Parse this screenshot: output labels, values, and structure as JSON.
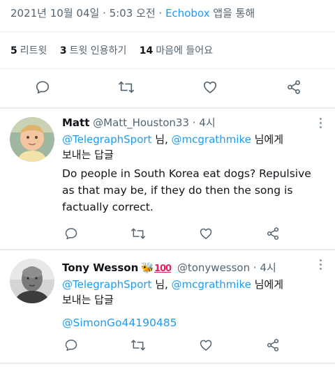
{
  "tweet": {
    "timestamp": "2021년 10월 04일 · 5:03 오전 · ",
    "source_link": "Echobox",
    "source_suffix": " 앱을 통해",
    "retweets_count": "5",
    "retweets_label": "리트윗",
    "quotes_count": "3",
    "quotes_label": "트윗 인용하기",
    "likes_count": "14",
    "likes_label": "마음에 들어요"
  },
  "replies": [
    {
      "name": "Matt",
      "handle": "@Matt_Houston33",
      "time": " · 4시",
      "reply_to_1": "@TelegraphSport",
      "reply_sep": " 님, ",
      "reply_to_2": "@mcgrathmike",
      "reply_suffix": " 님에게",
      "reply_line2": "보내는 답글",
      "text": "Do people in South Korea eat dogs? Repulsive as that may be, if they do then the song is factually correct."
    },
    {
      "name": "Tony Wesson",
      "emoji_1": "🐝",
      "emoji_2": "100",
      "handle": "@tonywesson",
      "time": " · 4시",
      "reply_to_1": "@TelegraphSport",
      "reply_sep": " 님, ",
      "reply_to_2": "@mcgrathmike",
      "reply_suffix": " 님에게",
      "reply_line2": "보내는 답글",
      "text": "@SimonGo44190485"
    }
  ],
  "icons": [
    "reply-icon",
    "retweet-icon",
    "like-icon",
    "share-icon",
    "more-icon"
  ],
  "colors": {
    "accent": "#1d9bf0",
    "muted": "#536471",
    "divider": "#e6ecf0"
  }
}
